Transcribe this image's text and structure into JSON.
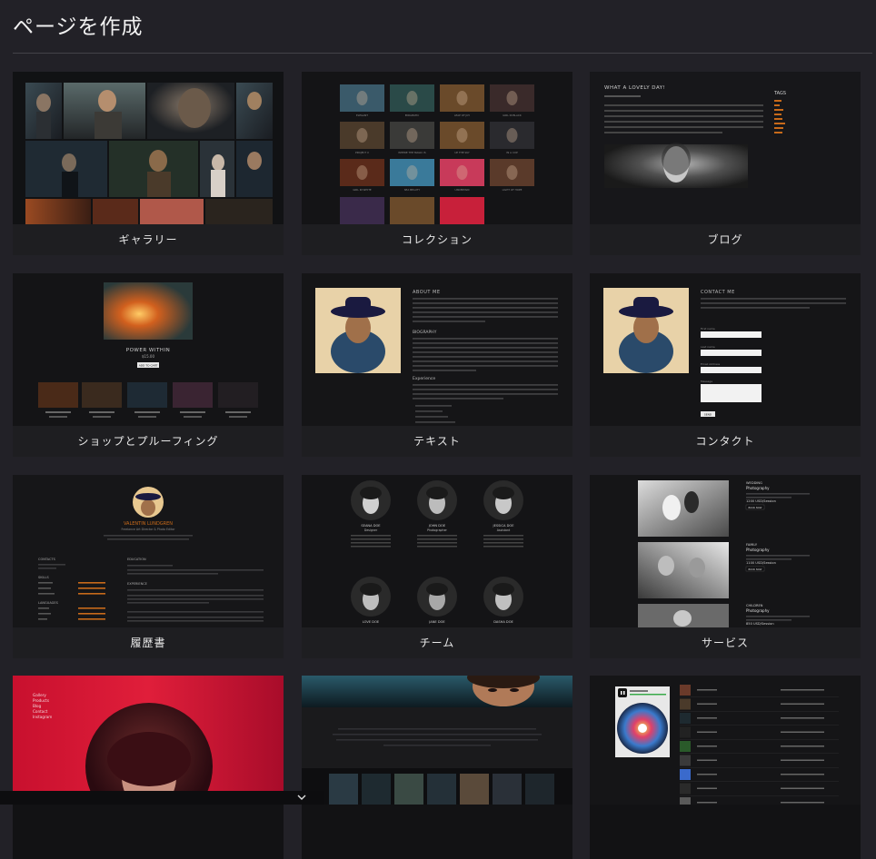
{
  "page": {
    "title": "ページを作成"
  },
  "cards": [
    {
      "label": "ギャラリー"
    },
    {
      "label": "コレクション"
    },
    {
      "label": "ブログ"
    },
    {
      "label": "ショップとプルーフィング"
    },
    {
      "label": "テキスト"
    },
    {
      "label": "コンタクト"
    },
    {
      "label": "履歴書"
    },
    {
      "label": "チーム"
    },
    {
      "label": "サービス"
    },
    {
      "label": ""
    },
    {
      "label": ""
    },
    {
      "label": ""
    }
  ],
  "previews": {
    "collection": [
      "ELEGANT",
      "ENIGMATIC",
      "LEAP OF JOY",
      "GIRL IN BLACK",
      "PROJECT X",
      "WHERE THE MAGIC IS",
      "UP THE SKY",
      "IN A CUP",
      "GIRL IN WHITE",
      "SEA BEAUTY",
      "UNCERTAIN",
      "LIGHT OF HOPE"
    ],
    "blog": {
      "heading": "WHAT A LOVELY DAY!",
      "tags_title": "TAGS"
    },
    "shop": {
      "heading": "POWER WITHIN",
      "price": "$15.00",
      "button": "ADD TO CART"
    },
    "text": {
      "about": "ABOUT ME",
      "biography": "BIOGRAPHY",
      "experience": "Experience"
    },
    "contact": {
      "heading": "CONTACT ME",
      "fields": [
        "First name",
        "Last name",
        "Email Address",
        "Message"
      ],
      "send": "SEND"
    },
    "resume": {
      "name": "VALENTIN LUNDGREN",
      "role": "Freelance Art Director & Photo Editor",
      "contacts": "CONTACTS",
      "skills": "SKILLS",
      "languages": "LANGUAGES",
      "education": "EDUCATION",
      "experience": "EXPERIENCE"
    },
    "team": [
      {
        "name": "SEANA DOE",
        "role": "Designer"
      },
      {
        "name": "JOHN DOE",
        "role": "Photographer"
      },
      {
        "name": "JESSICA DOE",
        "role": "Assistant"
      },
      {
        "name": "LOVE DOE",
        "role": ""
      },
      {
        "name": "JANE DOE",
        "role": ""
      },
      {
        "name": "DASHA DOE",
        "role": ""
      }
    ],
    "services": [
      {
        "name": "WEDDING",
        "sub": "Photography",
        "price": "1200 USD/Session",
        "button": "BOOK NOW"
      },
      {
        "name": "FAMILY",
        "sub": "Photography",
        "price": "1100 USD/Session",
        "button": "BOOK NOW"
      },
      {
        "name": "CHILDREN",
        "sub": "Photography",
        "price": "850 USD/Session",
        "button": ""
      }
    ],
    "menu": [
      "Gallery",
      "Products",
      "Blog",
      "Contact",
      "Instagram"
    ]
  }
}
